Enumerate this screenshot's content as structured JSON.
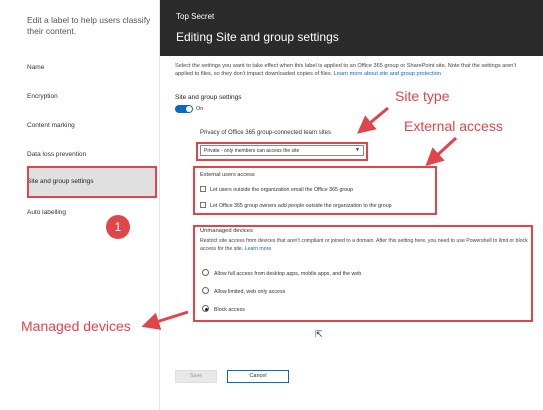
{
  "left_panel": {
    "description": "Edit a label to help users classify their content.",
    "nav_items": [
      {
        "label": "Name"
      },
      {
        "label": "Encryption"
      },
      {
        "label": "Content marking"
      },
      {
        "label": "Data loss prevention"
      },
      {
        "label": "Site and group settings",
        "active": true
      },
      {
        "label": "Auto labelling"
      }
    ]
  },
  "header": {
    "parent_label": "Top Secret",
    "title": "Editing Site and group settings"
  },
  "main": {
    "intro": "Select the settings you want to take effect when this label is applied to an Office 365 group or SharePoint site. Note that the settings aren't applied to files, so they don't impact downloaded copies of files.",
    "intro_link": "Learn more about site and group protection",
    "site_group_settings": {
      "label": "Site and group settings",
      "toggle_state": "On"
    },
    "privacy": {
      "label": "Privacy of Office 365 group-connected team sites",
      "selected": "Private - only members can access the site"
    },
    "external_access": {
      "title": "External users access",
      "options": [
        {
          "label": "Let users outside the organization email the Office 365 group"
        },
        {
          "label": "Let Office 365 group owners add people outside the organization to the group"
        }
      ]
    },
    "unmanaged_devices": {
      "title": "Unmanaged devices",
      "description": "Restrict site access from devices that aren't compliant or joined to a domain. After this setting here, you need to use Powershell to limit or block access for the site.",
      "link": "Learn more",
      "options": [
        {
          "label": "Allow full access from desktop apps, mobile apps, and the web",
          "selected": false
        },
        {
          "label": "Allow limited, web only access",
          "selected": false
        },
        {
          "label": "Block access",
          "selected": true
        }
      ]
    },
    "buttons": {
      "save": "Save",
      "cancel": "Cancel"
    }
  },
  "annotations": {
    "step_number": "1",
    "site_type": "Site type",
    "external_access": "External access",
    "managed_devices": "Managed devices",
    "color": "#e0454a"
  }
}
